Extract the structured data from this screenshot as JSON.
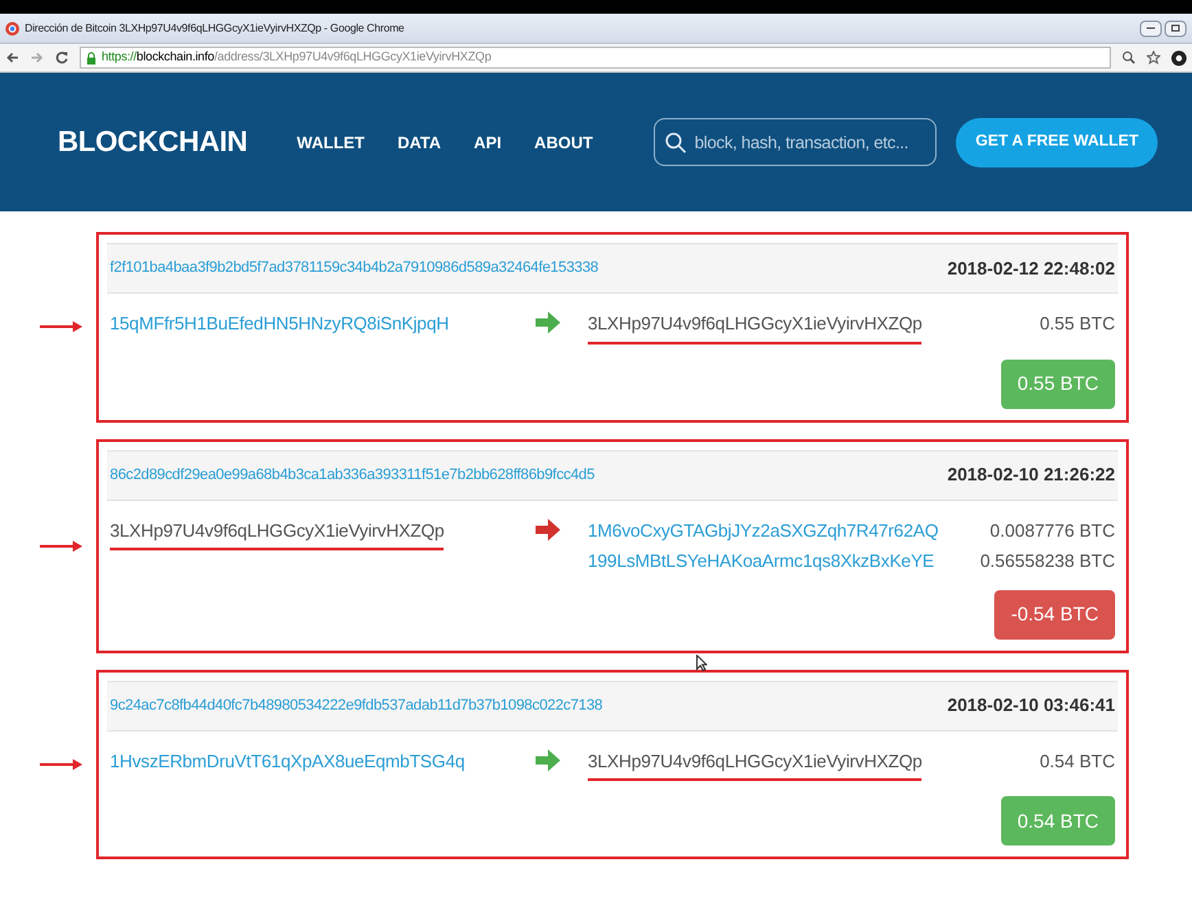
{
  "window": {
    "title": "Dirección de Bitcoin 3LXHp97U4v9f6qLHGGcyX1ieVyirvHXZQp - Google Chrome"
  },
  "address_bar": {
    "scheme": "https://",
    "host": "blockchain.info",
    "path": "/address/3LXHp97U4v9f6qLHGGcyX1ieVyirvHXZQp"
  },
  "header": {
    "logo": "BLOCKCHAIN",
    "nav": [
      "WALLET",
      "DATA",
      "API",
      "ABOUT"
    ],
    "search": {
      "placeholder": "block, hash, transaction, etc..."
    },
    "cta": "GET A FREE WALLET"
  },
  "transactions": [
    {
      "hash": "f2f101ba4baa3f9b2bd5f7ad3781159c34b4b2a7910986d589a32464fe153338",
      "time": "2018-02-12 22:48:02",
      "kind": "incoming",
      "inputs": [
        {
          "address": "15qMFfr5H1BuEfedHN5HNzyRQ8iSnKjpqH",
          "own": false
        }
      ],
      "outputs": [
        {
          "address": "3LXHp97U4v9f6qLHGGcyX1ieVyirvHXZQp",
          "own": true,
          "amount": "0.55 BTC"
        }
      ],
      "result": {
        "kind": "positive",
        "text": "0.55 BTC"
      }
    },
    {
      "hash": "86c2d89cdf29ea0e99a68b4b3ca1ab336a393311f51e7b2bb628ff86b9fcc4d5",
      "time": "2018-02-10 21:26:22",
      "kind": "outgoing",
      "inputs": [
        {
          "address": "3LXHp97U4v9f6qLHGGcyX1ieVyirvHXZQp",
          "own": true
        }
      ],
      "outputs": [
        {
          "address": "1M6voCxyGTAGbjJYz2aSXGZqh7R47r62AQ",
          "own": false,
          "amount": "0.0087776 BTC"
        },
        {
          "address": "199LsMBtLSYeHAKoaArmc1qs8XkzBxKeYE",
          "own": false,
          "amount": "0.56558238 BTC"
        }
      ],
      "result": {
        "kind": "negative",
        "text": "-0.54 BTC"
      }
    },
    {
      "hash": "9c24ac7c8fb44d40fc7b48980534222e9fdb537adab11d7b37b1098c022c7138",
      "time": "2018-02-10 03:46:41",
      "kind": "incoming",
      "inputs": [
        {
          "address": "1HvszERbmDruVtT61qXpAX8ueEqmbTSG4q",
          "own": false
        }
      ],
      "outputs": [
        {
          "address": "3LXHp97U4v9f6qLHGGcyX1ieVyirvHXZQp",
          "own": true,
          "amount": "0.54 BTC"
        }
      ],
      "result": {
        "kind": "positive",
        "text": "0.54 BTC"
      }
    }
  ]
}
